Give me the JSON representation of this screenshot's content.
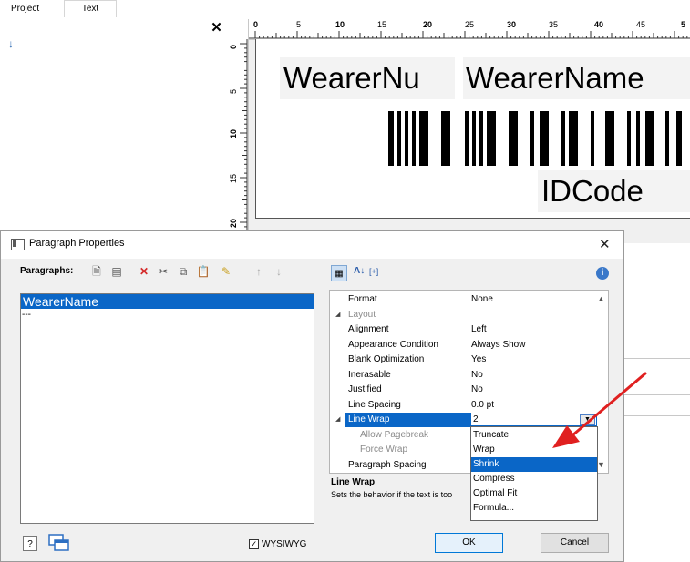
{
  "app": {
    "tabs": [
      "Project",
      "Text"
    ]
  },
  "ruler": {
    "h_ticks": [
      "0",
      "5",
      "10",
      "15",
      "20",
      "25",
      "30",
      "35",
      "40",
      "45",
      "5"
    ],
    "v_ticks": [
      "0",
      "5",
      "10",
      "15",
      "20"
    ]
  },
  "label": {
    "field1": "WearerNu",
    "field2": "WearerName",
    "field3": "IDCode"
  },
  "dialog": {
    "title": "Paragraph Properties",
    "paragraphs_label": "Paragraphs:",
    "paragraph_items": [
      "WearerName",
      "---"
    ],
    "properties": [
      {
        "name": "Format",
        "value": "None",
        "kind": "prop"
      },
      {
        "name": "Layout",
        "value": "",
        "kind": "cat"
      },
      {
        "name": "Alignment",
        "value": "Left",
        "kind": "prop"
      },
      {
        "name": "Appearance Condition",
        "value": "Always Show",
        "kind": "prop"
      },
      {
        "name": "Blank Optimization",
        "value": "Yes",
        "kind": "prop"
      },
      {
        "name": "Inerasable",
        "value": "No",
        "kind": "prop"
      },
      {
        "name": "Justified",
        "value": "No",
        "kind": "prop"
      },
      {
        "name": "Line Spacing",
        "value": "0.0 pt",
        "kind": "prop"
      },
      {
        "name": "Line Wrap",
        "value": "2",
        "kind": "sel"
      },
      {
        "name": "Allow Pagebreak",
        "value": "",
        "kind": "dim"
      },
      {
        "name": "Force Wrap",
        "value": "",
        "kind": "dim"
      },
      {
        "name": "Paragraph Spacing",
        "value": "",
        "kind": "prop"
      }
    ],
    "line_wrap_value": "2",
    "dropdown_options": [
      "Truncate",
      "Wrap",
      "Shrink",
      "Compress",
      "Optimal Fit",
      "Formula..."
    ],
    "dropdown_highlighted": "Shrink",
    "help_title": "Line Wrap",
    "help_text": "Sets the behavior if the text is too",
    "wysiwyg_label": "WYSIWYG",
    "ok_label": "OK",
    "cancel_label": "Cancel"
  },
  "colors": {
    "selection": "#0a66c7",
    "annotation_arrow": "#e02020"
  }
}
